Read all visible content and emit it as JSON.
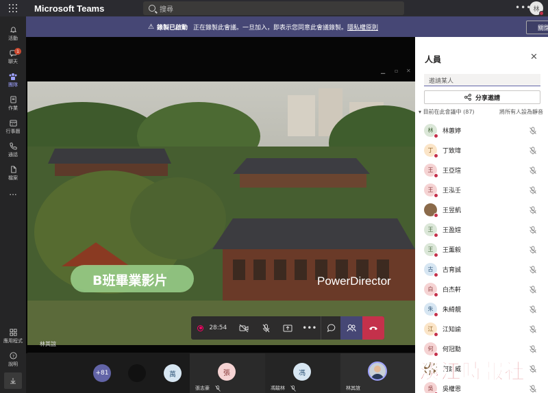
{
  "app": {
    "title": "Microsoft Teams",
    "search_placeholder": "搜尋",
    "user_initial": "林"
  },
  "rail": {
    "items": [
      {
        "label": "活動",
        "icon": "bell-icon"
      },
      {
        "label": "聊天",
        "icon": "chat-icon",
        "badge": "1"
      },
      {
        "label": "團隊",
        "icon": "teams-icon"
      },
      {
        "label": "作業",
        "icon": "assignments-icon"
      },
      {
        "label": "行事曆",
        "icon": "calendar-icon"
      },
      {
        "label": "通話",
        "icon": "phone-icon"
      },
      {
        "label": "檔案",
        "icon": "file-icon"
      }
    ],
    "more": "...",
    "apps_label": "應用程式",
    "help_label": "說明"
  },
  "banner": {
    "title": "錄製已啟動",
    "message": "正在錄製此會議。一旦加入，即表示您同意此會議錄製。",
    "link": "隱私權原則",
    "close_label": "關閉"
  },
  "video": {
    "caption": "B班畢業影片",
    "brand": "PowerDirector",
    "sharer": "林其誼"
  },
  "callbar": {
    "timer": "28:54"
  },
  "strip": {
    "overflow": "+81",
    "tiles": [
      {
        "initial": "萬"
      },
      {
        "initial": "張",
        "name": "張志豪"
      },
      {
        "initial": "馮",
        "name": "馮駿林"
      },
      {
        "name": "林其誼"
      }
    ]
  },
  "panel": {
    "title": "人員",
    "invite_placeholder": "邀請某人",
    "share_label": "分享邀請",
    "section_label": "目前在此會議中 (87)",
    "mute_all": "將所有人設為靜音",
    "people": [
      {
        "initial": "林",
        "name": "林蕙婷",
        "color": "#dbe7d8",
        "fg": "#4a6b41"
      },
      {
        "initial": "丁",
        "name": "丁致瑋",
        "color": "#fbe5c8",
        "fg": "#8a5a1a"
      },
      {
        "initial": "王",
        "name": "王亞瑄",
        "color": "#f5d3d3",
        "fg": "#8a3b3b"
      },
      {
        "initial": "王",
        "name": "王泓壬",
        "color": "#f5d3d3",
        "fg": "#8a3b3b"
      },
      {
        "initial": "",
        "name": "王昱凱",
        "color": "#8a6a4a",
        "fg": "#ffffff"
      },
      {
        "initial": "王",
        "name": "王盈媗",
        "color": "#dbe7d8",
        "fg": "#4a6b41"
      },
      {
        "initial": "王",
        "name": "王薰毅",
        "color": "#dbe7d8",
        "fg": "#4a6b41"
      },
      {
        "initial": "古",
        "name": "古育誠",
        "color": "#d7e6f2",
        "fg": "#3a5f80"
      },
      {
        "initial": "白",
        "name": "白杰軒",
        "color": "#f5d3d3",
        "fg": "#8a3b3b"
      },
      {
        "initial": "朱",
        "name": "朱綺靚",
        "color": "#d7e6f2",
        "fg": "#3a5f80"
      },
      {
        "initial": "江",
        "name": "江知諭",
        "color": "#fbe5c8",
        "fg": "#8a5a1a"
      },
      {
        "initial": "何",
        "name": "何冠勳",
        "color": "#f5d3d3",
        "fg": "#8a3b3b"
      },
      {
        "initial": "",
        "name": "何建威",
        "color": "#8a6a4a",
        "fg": "#ffffff"
      },
      {
        "initial": "吳",
        "name": "吳權恩",
        "color": "#f5d3d3",
        "fg": "#8a3b3b"
      }
    ]
  },
  "watermark": "淡江時報社"
}
